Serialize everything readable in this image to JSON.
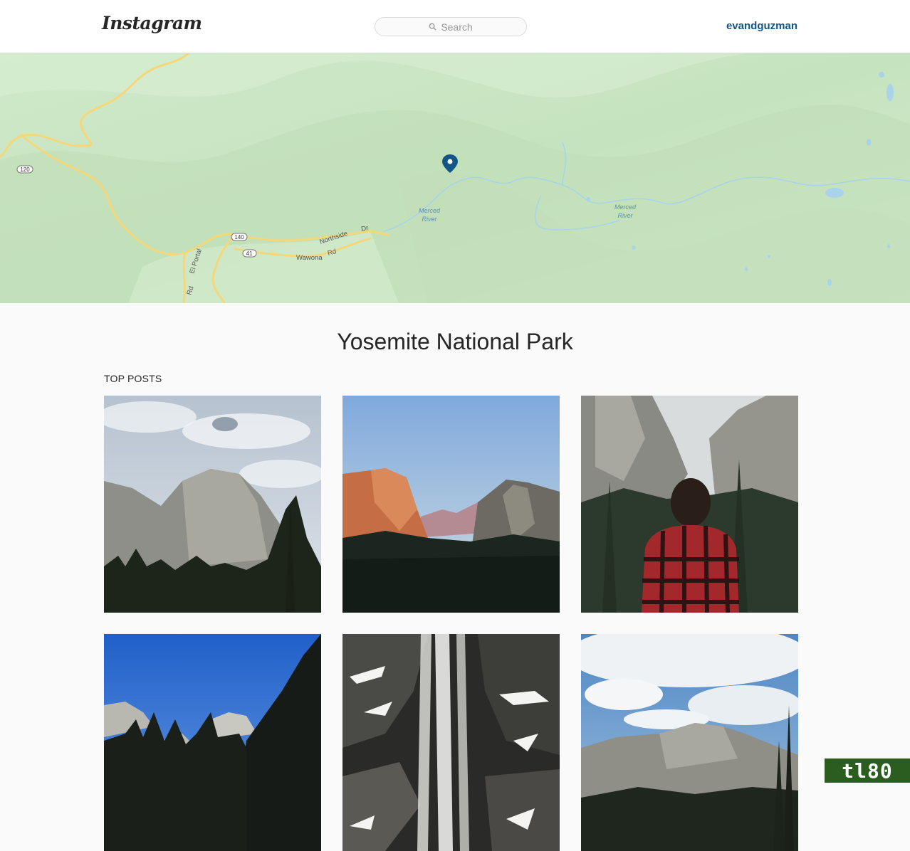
{
  "header": {
    "logo": "Instagram",
    "search_placeholder": "Search",
    "username": "evandguzman"
  },
  "map": {
    "labels": {
      "road_120": "120",
      "road_140": "140",
      "road_41": "41",
      "northside": "Northside",
      "dr": "Dr",
      "wawona": "Wawona",
      "rd": "Rd",
      "el_portal": "El Portal",
      "rd2": "Rd",
      "merced": "Merced",
      "river": "River",
      "merced2": "Merced",
      "river2": "River"
    },
    "colors": {
      "land": "#cfe8c8",
      "road": "#f5d77a",
      "water": "#a9d3ea",
      "pin": "#125688"
    }
  },
  "location": {
    "title": "Yosemite National Park"
  },
  "posts": {
    "section_label": "TOP POSTS",
    "items": [
      {
        "name": "el-capitan-cloudy"
      },
      {
        "name": "tunnel-view-sunset"
      },
      {
        "name": "person-red-plaid"
      },
      {
        "name": "half-dome-blue-sky"
      },
      {
        "name": "waterfall-snow"
      },
      {
        "name": "valley-clouds"
      }
    ]
  },
  "watermark": "tl80"
}
